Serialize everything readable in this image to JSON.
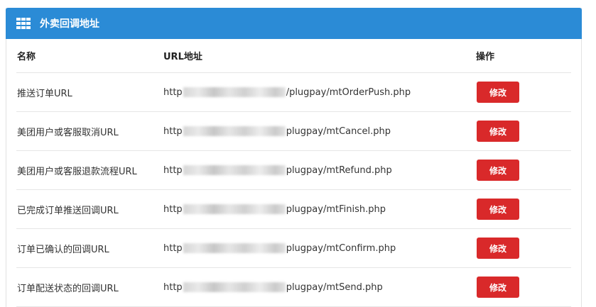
{
  "panel": {
    "title": "外卖回调地址",
    "icon": "grid-icon"
  },
  "table": {
    "headers": {
      "name": "名称",
      "url": "URL地址",
      "action": "操作"
    },
    "rows": [
      {
        "name": "推送订单URL",
        "url_prefix": "http",
        "url_suffix": "/plugpay/mtOrderPush.php",
        "action": "修改"
      },
      {
        "name": "美团用户或客服取消URL",
        "url_prefix": "http",
        "url_suffix": "plugpay/mtCancel.php",
        "action": "修改"
      },
      {
        "name": "美团用户或客服退款流程URL",
        "url_prefix": "http",
        "url_suffix": "plugpay/mtRefund.php",
        "action": "修改"
      },
      {
        "name": "已完成订单推送回调URL",
        "url_prefix": "http",
        "url_suffix": "plugpay/mtFinish.php",
        "action": "修改"
      },
      {
        "name": "订单已确认的回调URL",
        "url_prefix": "http",
        "url_suffix": "plugpay/mtConfirm.php",
        "action": "修改"
      },
      {
        "name": "订单配送状态的回调URL",
        "url_prefix": "http",
        "url_suffix": "plugpay/mtSend.php",
        "action": "修改"
      }
    ]
  },
  "colors": {
    "header_bg": "#2b8bd6",
    "button_bg": "#d9292a"
  }
}
